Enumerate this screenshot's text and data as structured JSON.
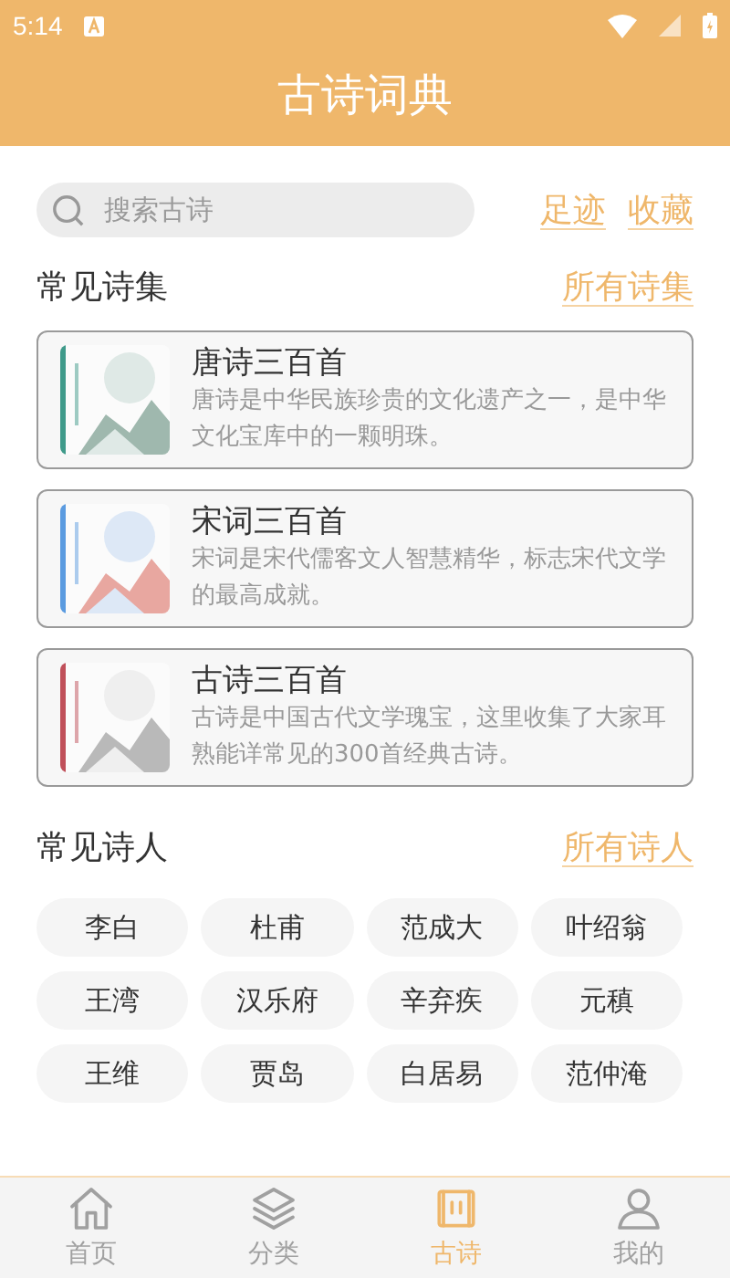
{
  "status_bar": {
    "time": "5:14"
  },
  "header": {
    "title": "古诗词典"
  },
  "search": {
    "placeholder": "搜索古诗"
  },
  "quick_links": [
    "足迹",
    "收藏"
  ],
  "collections": {
    "title": "常见诗集",
    "more": "所有诗集",
    "items": [
      {
        "title": "唐诗三百首",
        "description": "唐诗是中华民族珍贵的文化遗产之一，是中华文化宝库中的一颗明珠。"
      },
      {
        "title": "宋词三百首",
        "description": "宋词是宋代儒客文人智慧精华，标志宋代文学的最高成就。"
      },
      {
        "title": "古诗三百首",
        "description": "古诗是中国古代文学瑰宝，这里收集了大家耳熟能详常见的300首经典古诗。"
      }
    ]
  },
  "poets": {
    "title": "常见诗人",
    "more": "所有诗人",
    "items": [
      "李白",
      "杜甫",
      "范成大",
      "叶绍翁",
      "王湾",
      "汉乐府",
      "辛弃疾",
      "元稹",
      "王维",
      "贾岛",
      "白居易",
      "范仲淹"
    ]
  },
  "tab_bar": [
    {
      "label": "首页",
      "kind": "home",
      "selected": false
    },
    {
      "label": "分类",
      "kind": "layers",
      "selected": false
    },
    {
      "label": "古诗",
      "kind": "scroll",
      "selected": true
    },
    {
      "label": "我的",
      "kind": "user",
      "selected": false
    }
  ]
}
